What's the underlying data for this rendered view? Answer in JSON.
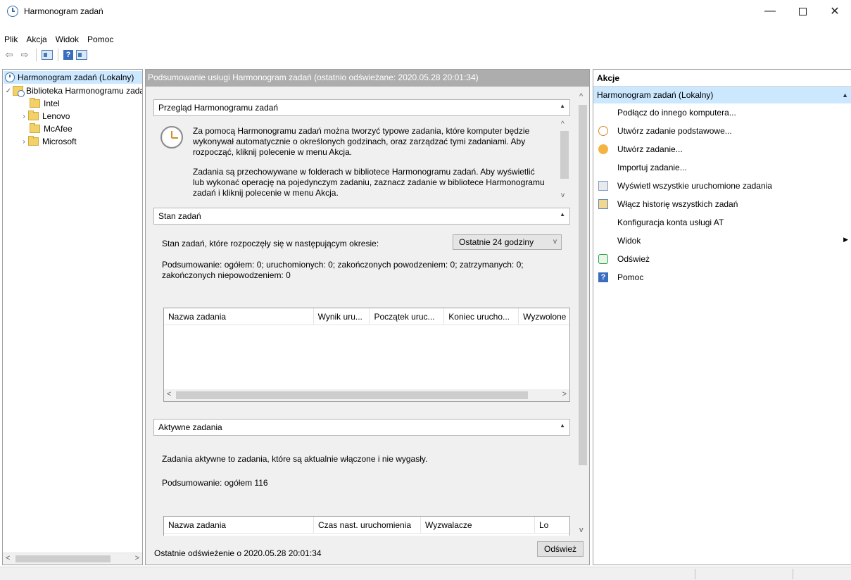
{
  "window": {
    "title": "Harmonogram zadań",
    "minimize_glyph": "—",
    "close_glyph": "✕"
  },
  "menu": [
    "Plik",
    "Akcja",
    "Widok",
    "Pomoc"
  ],
  "toolbar": {
    "back_glyph": "⇦",
    "forward_glyph": "⇨",
    "help_glyph": "?"
  },
  "tree": {
    "root": "Harmonogram zadań (Lokalny)",
    "library": "Biblioteka Harmonogramu zadań",
    "folders": [
      {
        "label": "Intel",
        "expandable": false
      },
      {
        "label": "Lenovo",
        "expandable": true
      },
      {
        "label": "McAfee",
        "expandable": false
      },
      {
        "label": "Microsoft",
        "expandable": true
      }
    ],
    "expanded_glyph": "✓",
    "collapsed_glyph": "›",
    "scroll_left": "<",
    "scroll_right": ">"
  },
  "center": {
    "header": "Podsumowanie usługi Harmonogram zadań (ostatnio odświeżane: 2020.05.28 20:01:34)",
    "overview": {
      "title": "Przegląd Harmonogramu zadań",
      "paragraph1": "Za pomocą Harmonogramu zadań można tworzyć typowe zadania, które komputer będzie wykonywał automatycznie o określonych godzinach, oraz zarządzać tymi zadaniami. Aby rozpocząć, kliknij polecenie w menu Akcja.",
      "paragraph2": "Zadania są przechowywane w folderach w bibliotece Harmonogramu zadań. Aby wyświetlić lub wykonać operację na pojedynczym zadaniu, zaznacz zadanie w bibliotece Harmonogramu zadań i kliknij polecenie w menu Akcja."
    },
    "status": {
      "title": "Stan zadań",
      "period_label": "Stan zadań, które rozpoczęły się w następującym okresie:",
      "period_value": "Ostatnie 24 godziny",
      "summary": "Podsumowanie: ogółem: 0; uruchomionych: 0; zakończonych powodzeniem: 0; zatrzymanych: 0; zakończonych niepowodzeniem: 0",
      "columns": [
        "Nazwa zadania",
        "Wynik uru...",
        "Początek uruc...",
        "Koniec urucho...",
        "Wyzwolone"
      ]
    },
    "active": {
      "title": "Aktywne zadania",
      "description": "Zadania aktywne to zadania, które są aktualnie włączone i nie wygasły.",
      "summary": "Podsumowanie: ogółem 116",
      "columns": [
        "Nazwa zadania",
        "Czas nast. uruchomienia",
        "Wyzwalacze",
        "Lo"
      ]
    },
    "footer": "Ostatnie odświeżenie o 2020.05.28 20:01:34",
    "refresh_button": "Odśwież",
    "collapse_glyph": "▲",
    "scroll_up": "^",
    "scroll_down": "v",
    "dropdown_arrow": "v",
    "grid_scroll_left": "<",
    "grid_scroll_right": ">"
  },
  "actions": {
    "title": "Akcje",
    "group": "Harmonogram zadań (Lokalny)",
    "group_arrow": "▲",
    "submenu_arrow": "▶",
    "items": [
      {
        "label": "Podłącz do innego komputera...",
        "icon": ""
      },
      {
        "label": "Utwórz zadanie podstawowe...",
        "icon": "clock-icon"
      },
      {
        "label": "Utwórz zadanie...",
        "icon": "task-icon"
      },
      {
        "label": "Importuj zadanie...",
        "icon": ""
      },
      {
        "label": "Wyświetl wszystkie uruchomione zadania",
        "icon": "running-tasks-icon"
      },
      {
        "label": "Włącz historię wszystkich zadań",
        "icon": "history-icon"
      },
      {
        "label": "Konfiguracja konta usługi AT",
        "icon": ""
      },
      {
        "label": "Widok",
        "icon": "",
        "submenu": true
      },
      {
        "label": "Odśwież",
        "icon": "refresh-icon"
      },
      {
        "label": "Pomoc",
        "icon": "help-icon"
      }
    ]
  }
}
